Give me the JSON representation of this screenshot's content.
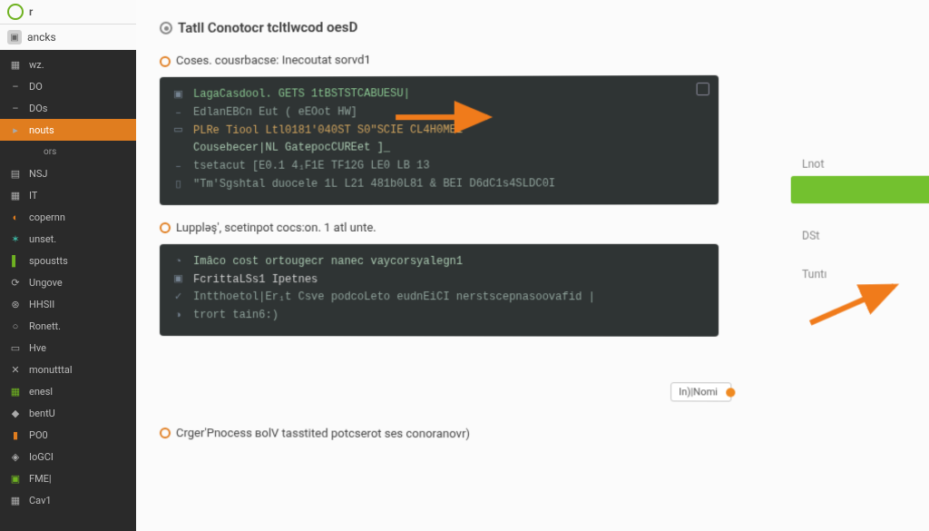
{
  "app": {
    "short": "r",
    "brand": "ancks"
  },
  "sidebar": [
    {
      "icon": "▦",
      "label": "wz."
    },
    {
      "icon": "–",
      "label": "DO",
      "cls": ""
    },
    {
      "icon": "–",
      "label": "DOs",
      "cls": ""
    },
    {
      "icon": "▸",
      "label": "nouts",
      "cls": "active"
    },
    {
      "icon": "",
      "label": "ors",
      "cls": "sub"
    },
    {
      "icon": "▤",
      "label": "NSJ"
    },
    {
      "icon": "▦",
      "label": "IT"
    },
    {
      "icon": "◐",
      "label": "copernn",
      "iconCls": "c-orange"
    },
    {
      "icon": "✶",
      "label": "unset.",
      "iconCls": "c-teal"
    },
    {
      "icon": "▌",
      "label": "spoustts",
      "iconCls": "c-green"
    },
    {
      "icon": "⟳",
      "label": "Ungove"
    },
    {
      "icon": "⊛",
      "label": "HHSII"
    },
    {
      "icon": "○",
      "label": "Ronett."
    },
    {
      "icon": "▭",
      "label": "Hve"
    },
    {
      "icon": "✕",
      "label": "monutttal"
    },
    {
      "icon": "▦",
      "label": "enesl",
      "iconCls": "c-green"
    },
    {
      "icon": "◆",
      "label": "bentU"
    },
    {
      "icon": "▮",
      "label": "PO0",
      "iconCls": "c-orange"
    },
    {
      "icon": "◈",
      "label": "IоGCI"
    },
    {
      "icon": "▣",
      "label": "FME|",
      "iconCls": "c-green"
    },
    {
      "icon": "▦",
      "label": "Cav1"
    }
  ],
  "page_title": "Tatll Conotocr tcltlwcod oesD",
  "steps": [
    {
      "caption": "Coses. cousrbacse: Inecoutat sorvd1",
      "lines": [
        {
          "g": "▣",
          "txt": "LagaCasdool.  GETS  1tBSTSTCABUESU|",
          "cls": "kw"
        },
        {
          "g": "–",
          "txt": "EdlanEBCn      Eut (  eEOot HW]",
          "cls": "dim"
        },
        {
          "g": "▭",
          "txt": "PLRe Tiool Ltl0181'040ST S0\"SCIE CL4H0ME1",
          "cls": "num"
        },
        {
          "g": "",
          "txt": "Cousebecer|NL GatepocCUREet ]_",
          "cls": "token"
        },
        {
          "g": "–",
          "txt": "tsetacut [E0.1 4₁F1E TF12G LE0 LB 13",
          "cls": "dim"
        },
        {
          "g": "▯",
          "txt": "\"Tm'Sgshtal duocele 1L L21  481b0L81  & BEI D6dC1s4SLDC0I",
          "cls": "dim"
        }
      ]
    },
    {
      "caption": "Luppləş', scetinpot cocs:on. 1 atl unte.",
      "lines": [
        {
          "g": "◔",
          "txt": "Imâco cost  ortougecr nanec vaycorsyalegn1",
          "cls": "token"
        },
        {
          "g": "▣",
          "txt": "FcrittaLSs1  Ipetnes",
          "cls": "cmd"
        },
        {
          "g": "✓",
          "txt": "Intthoetol|Er₁t  Csve podcoLeto   eudnEiCI nerstscepnasoovafid |",
          "cls": "dim"
        },
        {
          "g": "◑",
          "txt": "trort tain6:)",
          "cls": "dim"
        }
      ]
    }
  ],
  "chip": "In)|Nomi",
  "footer_caption": "Crger'Pnocess вolV  tasstited potcserot ses conoranovr)",
  "right": {
    "heading": "Lnot",
    "row1": "DSt",
    "row2": "Tuntı"
  }
}
